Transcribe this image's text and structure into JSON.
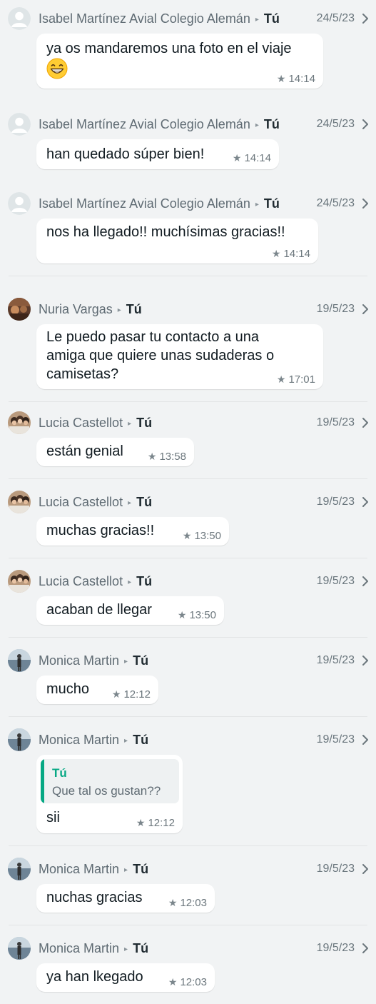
{
  "messages": [
    {
      "sender": "Isabel Martínez Avial Colegio Alemán",
      "recipient": "Tú",
      "date": "24/5/23",
      "text": "ya os mandaremos una foto en el viaje",
      "emoji": "grinning-face-with-smiling-eyes",
      "time": "14:14",
      "starred": true,
      "avatar": "default-avatar"
    },
    {
      "sender": "Isabel Martínez Avial Colegio Alemán",
      "recipient": "Tú",
      "date": "24/5/23",
      "text": "han quedado súper bien!",
      "time": "14:14",
      "starred": true,
      "avatar": "default-avatar"
    },
    {
      "sender": "Isabel Martínez Avial Colegio Alemán",
      "recipient": "Tú",
      "date": "24/5/23",
      "text": "nos ha llegado!!  muchísimas gracias!!",
      "time": "14:14",
      "starred": true,
      "avatar": "default-avatar"
    },
    {
      "sender": "Nuria Vargas",
      "recipient": "Tú",
      "date": "19/5/23",
      "text": "Le puedo pasar tu contacto a una\namiga que quiere unas sudaderas o\ncamisetas?",
      "time": "17:01",
      "starred": true,
      "avatar": "nuria-photo"
    },
    {
      "sender": "Lucia Castellot",
      "recipient": "Tú",
      "date": "19/5/23",
      "text": "están genial",
      "time": "13:58",
      "starred": true,
      "avatar": "lucia-photo"
    },
    {
      "sender": "Lucia Castellot",
      "recipient": "Tú",
      "date": "19/5/23",
      "text": "muchas gracias!!",
      "time": "13:50",
      "starred": true,
      "avatar": "lucia-photo"
    },
    {
      "sender": "Lucia Castellot",
      "recipient": "Tú",
      "date": "19/5/23",
      "text": "acaban de llegar",
      "time": "13:50",
      "starred": true,
      "avatar": "lucia-photo"
    },
    {
      "sender": "Monica Martin",
      "recipient": "Tú",
      "date": "19/5/23",
      "text": "mucho",
      "time": "12:12",
      "starred": true,
      "avatar": "monica-photo"
    },
    {
      "sender": "Monica Martin",
      "recipient": "Tú",
      "date": "19/5/23",
      "quote": {
        "author": "Tú",
        "text": "Que tal os gustan??"
      },
      "text": "sii",
      "time": "12:12",
      "starred": true,
      "avatar": "monica-photo"
    },
    {
      "sender": "Monica Martin",
      "recipient": "Tú",
      "date": "19/5/23",
      "text": "nuchas gracias",
      "time": "12:03",
      "starred": true,
      "avatar": "monica-photo"
    },
    {
      "sender": "Monica Martin",
      "recipient": "Tú",
      "date": "19/5/23",
      "text": "ya han lkegado",
      "time": "12:03",
      "starred": true,
      "avatar": "monica-photo"
    }
  ],
  "colors": {
    "background": "#f1f3f4",
    "bubble": "#ffffff",
    "quote_accent": "#06a884",
    "sender_text": "#5f6b73"
  },
  "icons": {
    "star": "star-icon",
    "chevron": "chevron-right-icon",
    "arrow": "triangle-right-icon"
  }
}
